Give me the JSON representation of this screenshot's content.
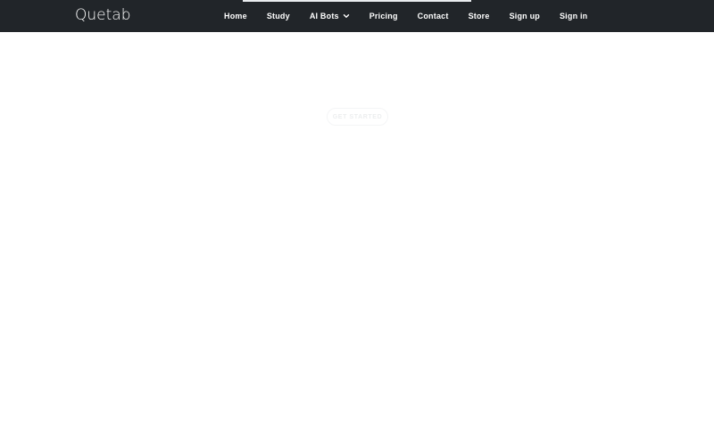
{
  "brand": {
    "name": "Quetab"
  },
  "nav": {
    "items": [
      {
        "label": "Home"
      },
      {
        "label": "Study"
      },
      {
        "label": "AI Bots",
        "icon": "chevron-down-icon"
      },
      {
        "label": "Pricing"
      },
      {
        "label": "Contact"
      },
      {
        "label": "Store"
      },
      {
        "label": "Sign up"
      },
      {
        "label": "Sign in"
      }
    ]
  },
  "hero": {
    "button_label": "GET STARTED"
  },
  "colors": {
    "navbar_bg": "#212529",
    "nav_text": "#ffffff",
    "page_bg": "#ffffff"
  }
}
